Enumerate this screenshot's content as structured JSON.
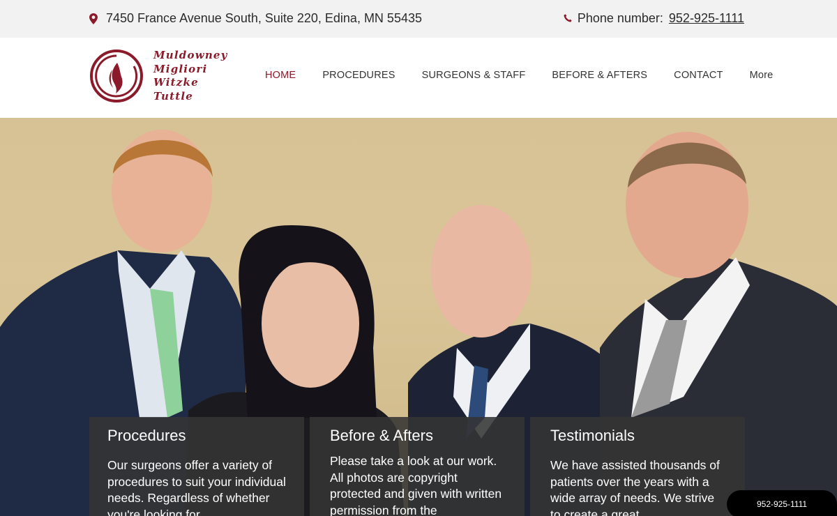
{
  "topbar": {
    "address": "7450 France Avenue South, Suite 220, Edina, MN 55435",
    "phone_label": "Phone number: ",
    "phone_number": "952-925-1111"
  },
  "logo": {
    "lines": [
      "Muldowney",
      "Migliori",
      "Witzke",
      "Tuttle"
    ]
  },
  "nav": {
    "items": [
      "HOME",
      "PROCEDURES",
      "SURGEONS & STAFF",
      "BEFORE & AFTERS",
      "CONTACT",
      "More"
    ],
    "active": "HOME"
  },
  "cards": [
    {
      "title": "Procedures",
      "body": "Our surgeons offer a variety of procedures to suit your individual needs. Regardless of whether you're looking for"
    },
    {
      "title": "Before & Afters",
      "body": "Please take a look at our work. All photos are copyright protected and given with written permission from the"
    },
    {
      "title": "Testimonials",
      "body": "We have assisted thousands of patients over the years with a wide array of needs. We strive to create a great"
    }
  ],
  "floating_phone": "952-925-1111",
  "colors": {
    "brand": "#8b1a2b",
    "topbar_bg": "#f2f2f2",
    "card_bg": "#343434",
    "hero_wall": "#d7c295"
  },
  "icons": {
    "address": "map-pin-icon",
    "phone": "phone-icon"
  }
}
